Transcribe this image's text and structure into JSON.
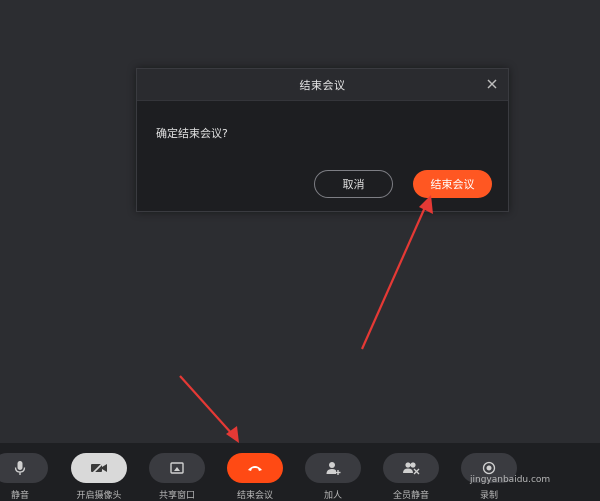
{
  "dialog": {
    "title": "结束会议",
    "message": "确定结束会议?",
    "cancel_label": "取消",
    "confirm_label": "结束会议"
  },
  "toolbar": {
    "items": [
      {
        "label": "静音",
        "icon": "microphone-icon"
      },
      {
        "label": "开启摄像头",
        "icon": "camera-off-icon"
      },
      {
        "label": "共享窗口",
        "icon": "share-screen-icon"
      },
      {
        "label": "结束会议",
        "icon": "hang-up-icon"
      },
      {
        "label": "加人",
        "icon": "add-person-icon"
      },
      {
        "label": "全员静音",
        "icon": "mute-all-icon"
      },
      {
        "label": "录制",
        "icon": "record-icon"
      }
    ]
  },
  "watermark": "jingyanbaidu.com",
  "colors": {
    "accent": "#ff5722",
    "hangup": "#ff4a14",
    "annotation": "#e53935"
  }
}
